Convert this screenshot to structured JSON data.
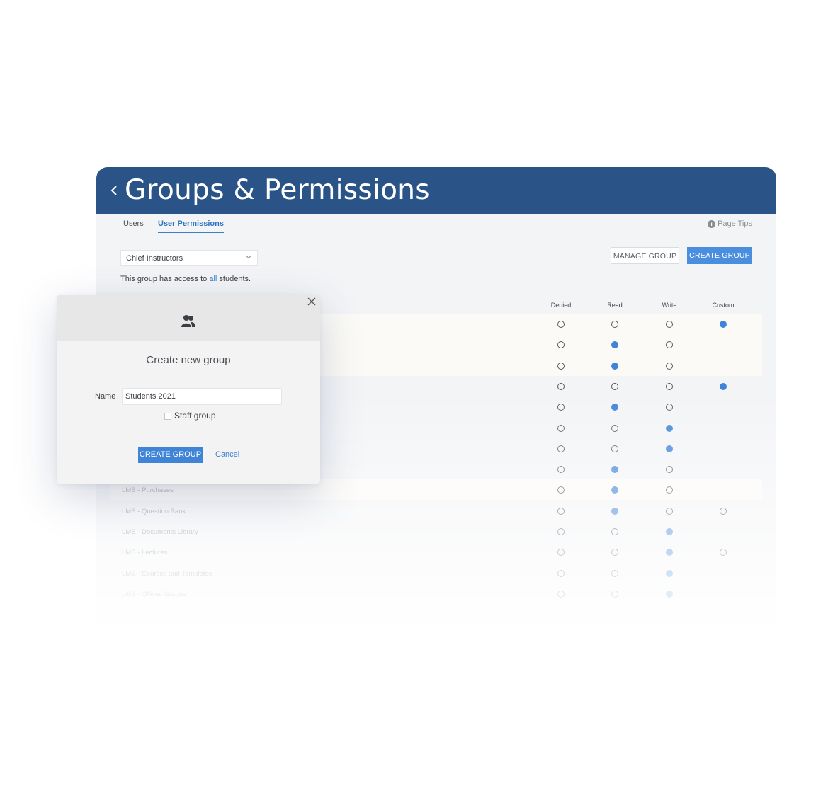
{
  "app": {
    "title": "Groups & Permissions",
    "back_icon": "chevron-left-icon"
  },
  "tabs": [
    {
      "label": "Users",
      "active": false
    },
    {
      "label": "User Permissions",
      "active": true
    }
  ],
  "page_tips": {
    "label": "Page Tips",
    "icon": "info-icon"
  },
  "group_select": {
    "value": "Chief Instructors"
  },
  "access": {
    "prefix": "This group has access to ",
    "link": "all",
    "suffix": " students."
  },
  "buttons": {
    "manage_group": "MANAGE GROUP",
    "create_group": "CREATE GROUP"
  },
  "columns": [
    "Denied",
    "Read",
    "Write",
    "Custom"
  ],
  "rows": [
    {
      "label": "",
      "value": "Custom",
      "has_custom": true
    },
    {
      "label": "",
      "value": "Read",
      "has_custom": false
    },
    {
      "label": "",
      "value": "Read",
      "has_custom": false
    },
    {
      "label": "",
      "value": "Custom",
      "has_custom": true
    },
    {
      "label": "",
      "value": "Read",
      "has_custom": false
    },
    {
      "label": "",
      "value": "Write",
      "has_custom": false
    },
    {
      "label": "",
      "value": "Write",
      "has_custom": false
    },
    {
      "label": "",
      "value": "Read",
      "has_custom": false
    },
    {
      "label": "LMS - Purchases",
      "value": "Read",
      "has_custom": false
    },
    {
      "label": "LMS - Question Bank",
      "value": "Read",
      "has_custom": true
    },
    {
      "label": "LMS - Documents Library",
      "value": "Write",
      "has_custom": false
    },
    {
      "label": "LMS - Lectures",
      "value": "Write",
      "has_custom": true
    },
    {
      "label": "LMS - Courses and Templates",
      "value": "Write",
      "has_custom": false
    },
    {
      "label": "LMS - Official Grades",
      "value": "Write",
      "has_custom": false
    }
  ],
  "modal": {
    "icon": "group-icon",
    "close_icon": "close-icon",
    "title": "Create new group",
    "name_label": "Name",
    "name_value": "Students 2021",
    "staff_label": "Staff group",
    "staff_checked": false,
    "create_label": "CREATE GROUP",
    "cancel_label": "Cancel"
  },
  "colors": {
    "header": "#2a5487",
    "accent": "#3f84d6"
  }
}
